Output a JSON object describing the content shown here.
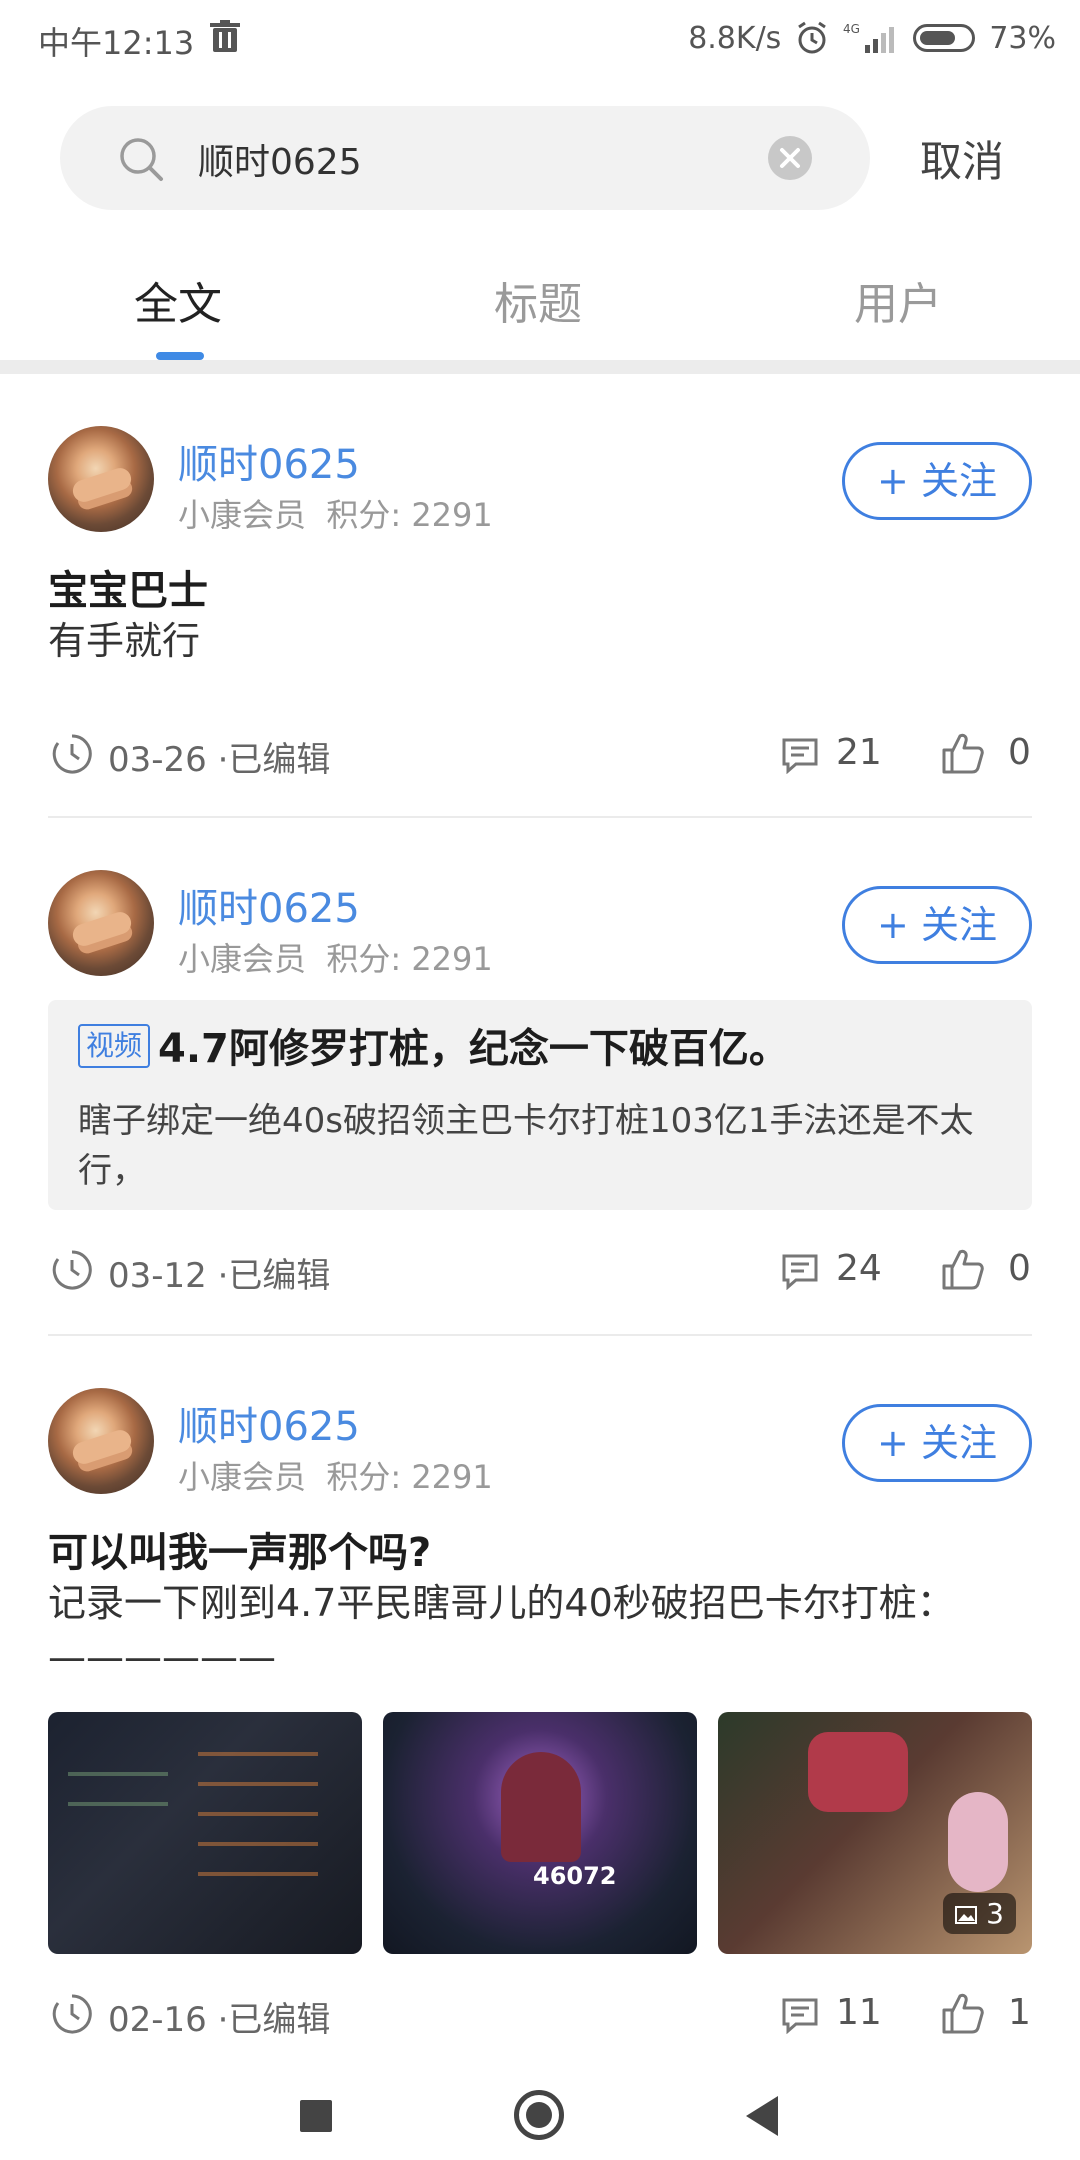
{
  "status_bar": {
    "time": "中午12:13",
    "net_speed": "8.8K/s",
    "signal": "4G",
    "battery": "73%",
    "battery_level": 0.73
  },
  "search": {
    "value": "顺时0625",
    "cancel_label": "取消"
  },
  "tabs": [
    {
      "label": "全文",
      "active": true
    },
    {
      "label": "标题",
      "active": false
    },
    {
      "label": "用户",
      "active": false
    }
  ],
  "posts": [
    {
      "username": "顺时0625",
      "member": "小康会员",
      "points": "积分: 2291",
      "follow_label": "+ 关注",
      "title": "宝宝巴士",
      "body": " 有手就行",
      "date": "03-26 ·已编辑",
      "comments": "21",
      "likes": "0"
    },
    {
      "username": "顺时0625",
      "member": "小康会员",
      "points": "积分: 2291",
      "follow_label": "+ 关注",
      "tag": "视频",
      "title": "4.7阿修罗打桩，纪念一下破百亿。",
      "body": " 瞎子绑定一绝40s破招领主巴卡尔打桩103亿1手法还是不太行，",
      "date": "03-12 ·已编辑",
      "comments": "24",
      "likes": "0"
    },
    {
      "username": "顺时0625",
      "member": "小康会员",
      "points": "积分: 2291",
      "follow_label": "+ 关注",
      "title": "可以叫我一声那个吗?",
      "body": " 记录一下刚到4.7平民瞎哥儿的40秒破招巴卡尔打桩：——————",
      "image_count": "3",
      "thumb_number": "46072",
      "date": "02-16 ·已编辑",
      "comments": "11",
      "likes": "1"
    }
  ],
  "colors": {
    "accent": "#3f8ae5",
    "username": "#4a8ae0"
  }
}
